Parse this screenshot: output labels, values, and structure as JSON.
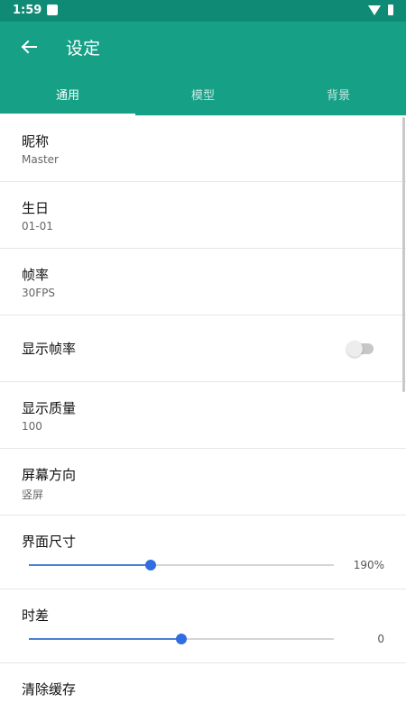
{
  "status_bar": {
    "time": "1:59"
  },
  "app_bar": {
    "title": "设定"
  },
  "tabs": [
    {
      "label": "通用",
      "active": true
    },
    {
      "label": "模型",
      "active": false
    },
    {
      "label": "背景",
      "active": false
    }
  ],
  "settings": {
    "nickname": {
      "title": "昵称",
      "value": "Master"
    },
    "birthday": {
      "title": "生日",
      "value": "01-01"
    },
    "framerate": {
      "title": "帧率",
      "value": "30FPS"
    },
    "show_framerate": {
      "title": "显示帧率",
      "enabled": false
    },
    "display_quality": {
      "title": "显示质量",
      "value": "100"
    },
    "orientation": {
      "title": "屏幕方向",
      "value": "竖屏"
    },
    "ui_size": {
      "title": "界面尺寸",
      "value_label": "190%",
      "fraction": 0.4
    },
    "time_offset": {
      "title": "时差",
      "value_label": "0",
      "fraction": 0.5
    },
    "clear_cache": {
      "title": "清除缓存"
    }
  },
  "colors": {
    "app_bar": "#16a086",
    "status_bar": "#0f8a75",
    "accent": "#2f6de0"
  }
}
